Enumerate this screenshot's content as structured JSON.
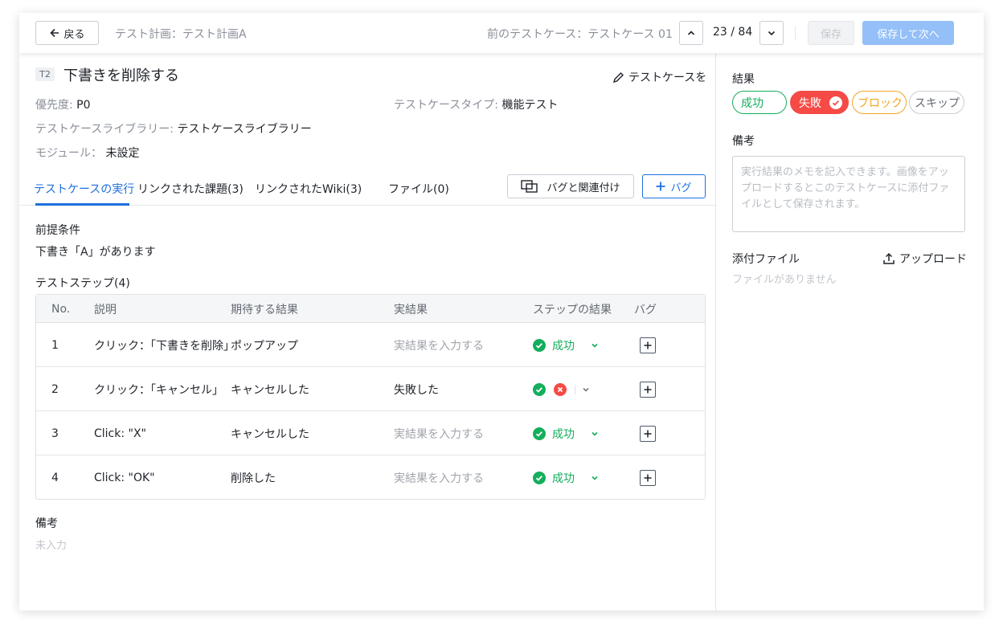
{
  "header": {
    "back_label": "戻る",
    "test_plan": "テスト計画：テスト計画A",
    "prev_case": "前のテストケース：テストケース 01",
    "position": "23 / 84",
    "save_label": "保存",
    "save_next_label": "保存して次へ"
  },
  "case": {
    "tag": "T2",
    "title": "下書きを削除する",
    "edit_label": "テストケースを",
    "priority_label": "優先度:",
    "priority_value": "P0",
    "type_label": "テストケースタイプ:",
    "type_value": "機能テスト",
    "library_label": "テストケースライブラリー:",
    "library_value": "テストケースライブラリー",
    "module_label": "モジュール：",
    "module_value": "未設定"
  },
  "tabs": [
    {
      "label": "テストケースの実行"
    },
    {
      "label": "リンクされた課題(3)"
    },
    {
      "label": "リンクされたWiki(3)"
    },
    {
      "label": "ファイル(0)"
    }
  ],
  "actions": {
    "link_bug_label": "バグと関連付け",
    "add_bug_label": "バグ"
  },
  "precondition": {
    "heading": "前提条件",
    "text": "下書き「A」があります"
  },
  "steps": {
    "heading": "テストステップ(4)",
    "columns": [
      "No.",
      "説明",
      "期待する結果",
      "実結果",
      "ステップの結果",
      "バグ"
    ],
    "rows": [
      {
        "no": "1",
        "desc": "クリック：「下書きを削除」",
        "expected": "ポップアップ",
        "actual": "実結果を入力する",
        "actual_placeholder": true,
        "result": "成功",
        "mixed": false
      },
      {
        "no": "2",
        "desc": "クリック：「キャンセル」",
        "expected": "キャンセルした",
        "actual": "失敗した",
        "actual_placeholder": false,
        "result": "",
        "mixed": true
      },
      {
        "no": "3",
        "desc": "Click: \"X\"",
        "expected": "キャンセルした",
        "actual": "実結果を入力する",
        "actual_placeholder": true,
        "result": "成功",
        "mixed": false
      },
      {
        "no": "4",
        "desc": "Click: \"OK\"",
        "expected": "削除した",
        "actual": "実結果を入力する",
        "actual_placeholder": true,
        "result": "成功",
        "mixed": false
      }
    ]
  },
  "notes": {
    "heading": "備考",
    "value": "未入力"
  },
  "side": {
    "result_heading": "結果",
    "results": [
      {
        "label": "成功",
        "color": "#14ae5c"
      },
      {
        "label": "失敗",
        "color": "#f54a45"
      },
      {
        "label": "ブロック",
        "color": "#f5a623"
      },
      {
        "label": "スキップ",
        "color": "#8a8f99"
      }
    ],
    "memo_heading": "備考",
    "memo_placeholder": "実行結果のメモを記入できます。画像をアップロードするとこのテストケースに添付ファイルとして保存されます。",
    "attach_heading": "添付ファイル",
    "upload_label": "アップロード",
    "no_files": "ファイルがありません"
  }
}
